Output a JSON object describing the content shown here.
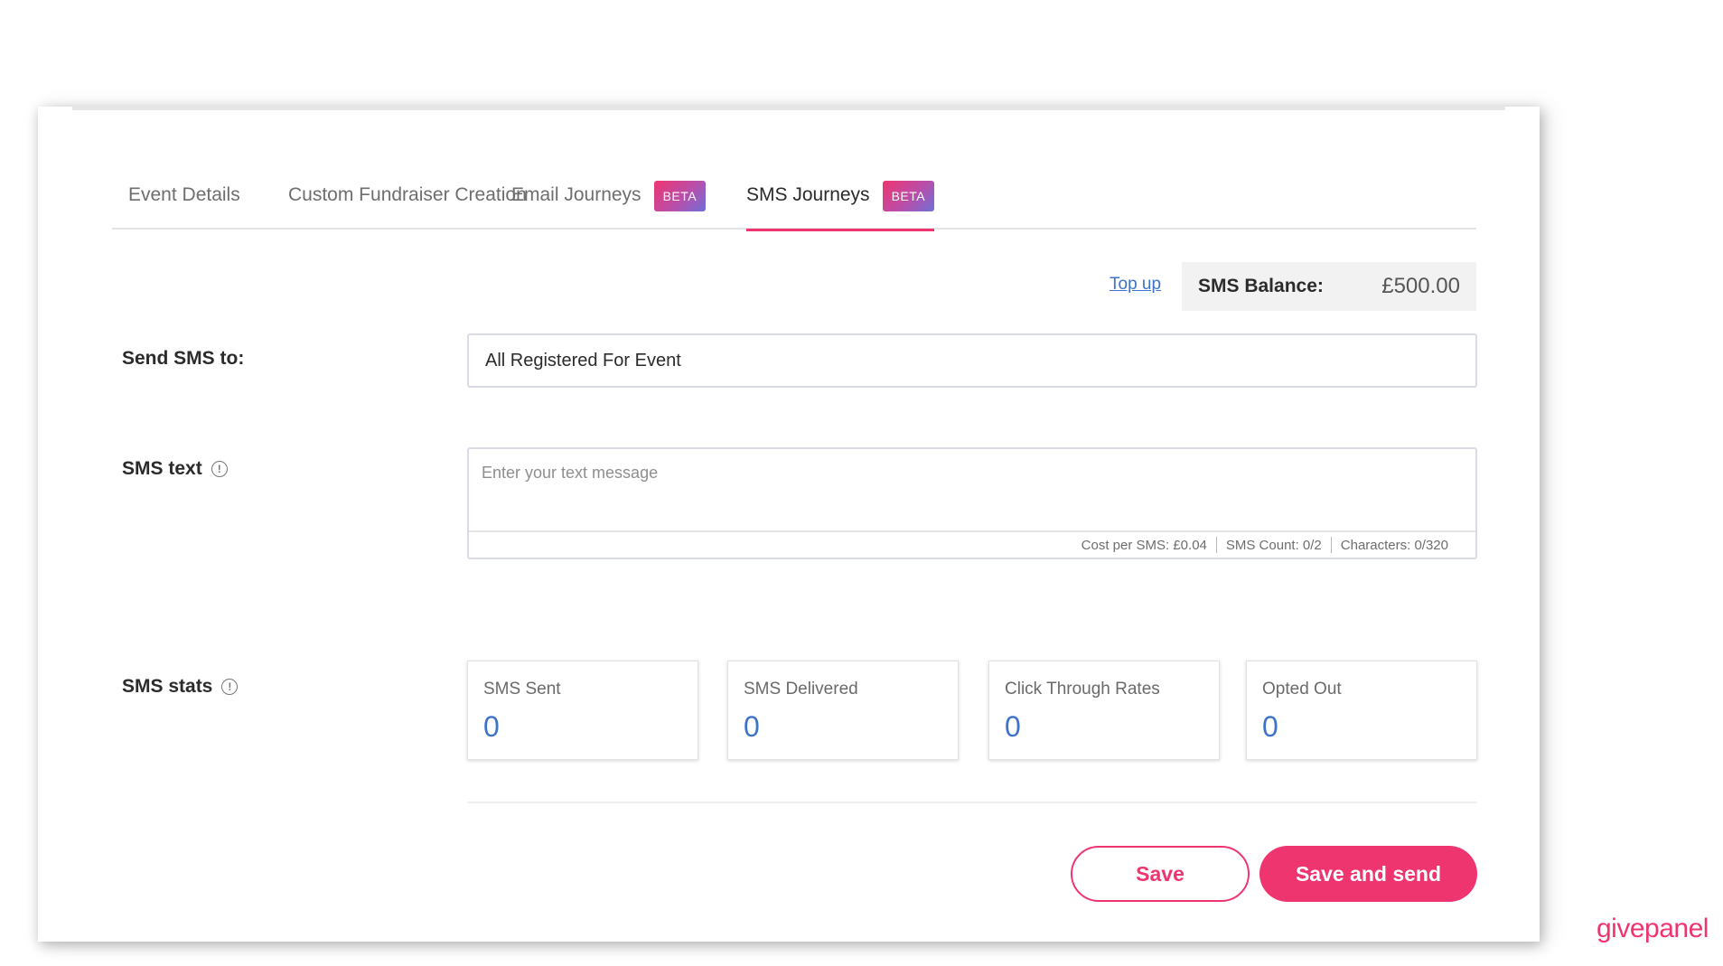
{
  "tabs": [
    {
      "label": "Event Details",
      "active": false
    },
    {
      "label": "Custom Fundraiser Creation",
      "active": false
    },
    {
      "label": "Email Journeys",
      "badge": "BETA",
      "active": false
    },
    {
      "label": "SMS Journeys",
      "badge": "BETA",
      "active": true
    }
  ],
  "balance": {
    "topup_label": "Top up",
    "label": "SMS Balance:",
    "value": "£500.00"
  },
  "send_to": {
    "label": "Send SMS to:",
    "value": "All Registered For Event"
  },
  "sms_text": {
    "label": "SMS text",
    "info_icon": "info-circle-icon",
    "placeholder": "Enter your text message",
    "cost": "Cost per SMS: £0.04",
    "count": "SMS Count: 0/2",
    "characters": "Characters:  0/320"
  },
  "stats": {
    "label": "SMS stats",
    "info_icon": "info-circle-icon",
    "items": [
      {
        "label": "SMS Sent",
        "value": "0"
      },
      {
        "label": "SMS Delivered",
        "value": "0"
      },
      {
        "label": "Click Through Rates",
        "value": "0"
      },
      {
        "label": "Opted Out",
        "value": "0"
      }
    ]
  },
  "actions": {
    "save_label": "Save",
    "save_send_label": "Save and send"
  },
  "brand": {
    "name": "givepanel"
  },
  "colors": {
    "accent": "#ee3570",
    "link": "#3d74c9",
    "stat_value": "#3d74c9",
    "balance_bg": "#f2f2f2"
  }
}
